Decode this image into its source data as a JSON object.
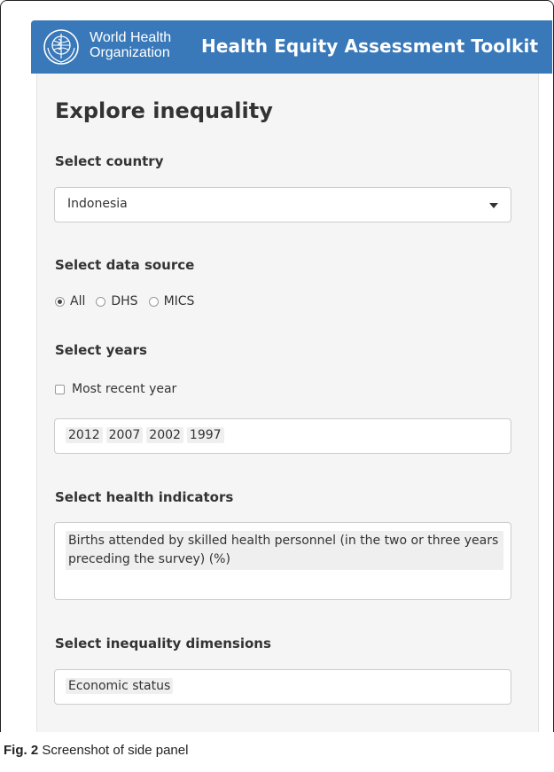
{
  "header": {
    "logo_line1": "World Health",
    "logo_line2": "Organization",
    "app_title": "Health Equity Assessment Toolkit"
  },
  "panel": {
    "title": "Explore inequality",
    "country": {
      "label": "Select country",
      "selected": "Indonesia"
    },
    "data_source": {
      "label": "Select data source",
      "options": [
        "All",
        "DHS",
        "MICS"
      ],
      "selected": "All"
    },
    "years": {
      "label": "Select years",
      "most_recent_label": "Most recent year",
      "most_recent_checked": false,
      "selected": [
        "2012",
        "2007",
        "2002",
        "1997"
      ]
    },
    "indicators": {
      "label": "Select health indicators",
      "selected": "Births attended by skilled health personnel (in the two or three years preceding the survey) (%)"
    },
    "dimensions": {
      "label": "Select inequality dimensions",
      "selected": "Economic status"
    }
  },
  "caption": {
    "prefix": "Fig. 2",
    "text": "Screenshot of side panel"
  },
  "colors": {
    "header_bg": "#3a79b9",
    "panel_bg": "#f5f5f5"
  }
}
